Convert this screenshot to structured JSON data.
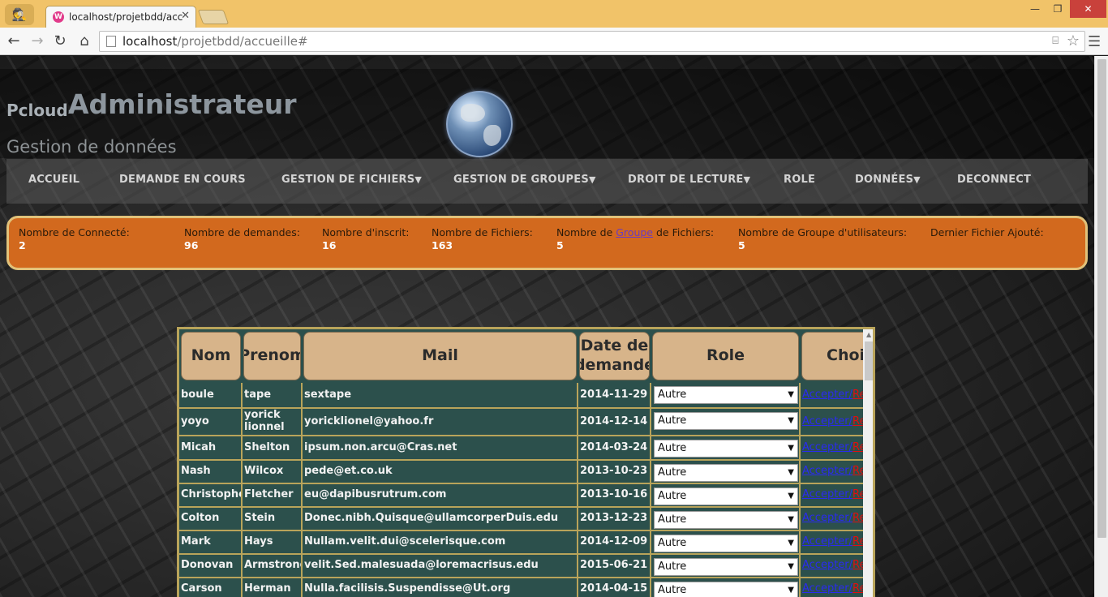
{
  "browser": {
    "tab_title": "localhost/projetbdd/accu",
    "url_host": "localhost",
    "url_path": "/projetbdd/accueille#"
  },
  "header": {
    "brand_small": "Pcloud-",
    "brand_big": "Administrateur",
    "subtitle": "Gestion de données"
  },
  "nav": {
    "items": [
      {
        "label": "ACCUEIL",
        "dropdown": false
      },
      {
        "label": "DEMANDE EN COURS",
        "dropdown": false
      },
      {
        "label": "GESTION DE FICHIERS",
        "dropdown": true
      },
      {
        "label": "GESTION DE GROUPES",
        "dropdown": true
      },
      {
        "label": "DROIT DE LECTURE",
        "dropdown": true
      },
      {
        "label": "ROLE",
        "dropdown": false
      },
      {
        "label": "DONNÉES",
        "dropdown": true
      },
      {
        "label": "DECONNECT",
        "dropdown": false
      }
    ]
  },
  "stats": {
    "connected_label": "Nombre de Connecté:",
    "connected_value": "2",
    "requests_label": "Nombre de demandes:",
    "requests_value": "96",
    "registered_label": "Nombre d'inscrit:",
    "registered_value": "16",
    "files_label": "Nombre de Fichiers:",
    "files_value": "163",
    "file_groups_prefix": "Nombre de ",
    "file_groups_link": "Groupe",
    "file_groups_suffix": " de Fichiers:",
    "file_groups_value": "5",
    "user_groups_label": "Nombre de Groupe d'utilisateurs:",
    "user_groups_value": "5",
    "last_file_label": "Dernier Fichier Ajouté:"
  },
  "table": {
    "headers": {
      "nom": "Nom",
      "prenom": "Prenom",
      "mail": "Mail",
      "date": "Date de demande",
      "role": "Role",
      "choix": "Choix"
    },
    "accept_label": "Accepter",
    "separator": "/",
    "refuse_label": "Refuser",
    "rows": [
      {
        "nom": "boule",
        "prenom": "tape",
        "mail": "sextape",
        "date": "2014-11-29",
        "role": "Autre"
      },
      {
        "nom": "yoyo",
        "prenom": "yorick lionnel",
        "mail": "yoricklionel@yahoo.fr",
        "date": "2014-12-14",
        "role": "Autre"
      },
      {
        "nom": "Micah",
        "prenom": "Shelton",
        "mail": "ipsum.non.arcu@Cras.net",
        "date": "2014-03-24",
        "role": "Autre"
      },
      {
        "nom": "Nash",
        "prenom": "Wilcox",
        "mail": "pede@et.co.uk",
        "date": "2013-10-23",
        "role": "Autre"
      },
      {
        "nom": "Christopher",
        "prenom": "Fletcher",
        "mail": "eu@dapibusrutrum.com",
        "date": "2013-10-16",
        "role": "Autre"
      },
      {
        "nom": "Colton",
        "prenom": "Stein",
        "mail": "Donec.nibh.Quisque@ullamcorperDuis.edu",
        "date": "2013-12-23",
        "role": "Autre"
      },
      {
        "nom": "Mark",
        "prenom": "Hays",
        "mail": "Nullam.velit.dui@scelerisque.com",
        "date": "2014-12-09",
        "role": "Autre"
      },
      {
        "nom": "Donovan",
        "prenom": "Armstrong",
        "mail": "velit.Sed.malesuada@loremacrisus.edu",
        "date": "2015-06-21",
        "role": "Autre"
      },
      {
        "nom": "Carson",
        "prenom": "Herman",
        "mail": "Nulla.facilisis.Suspendisse@Ut.org",
        "date": "2014-04-15",
        "role": "Autre"
      }
    ]
  }
}
